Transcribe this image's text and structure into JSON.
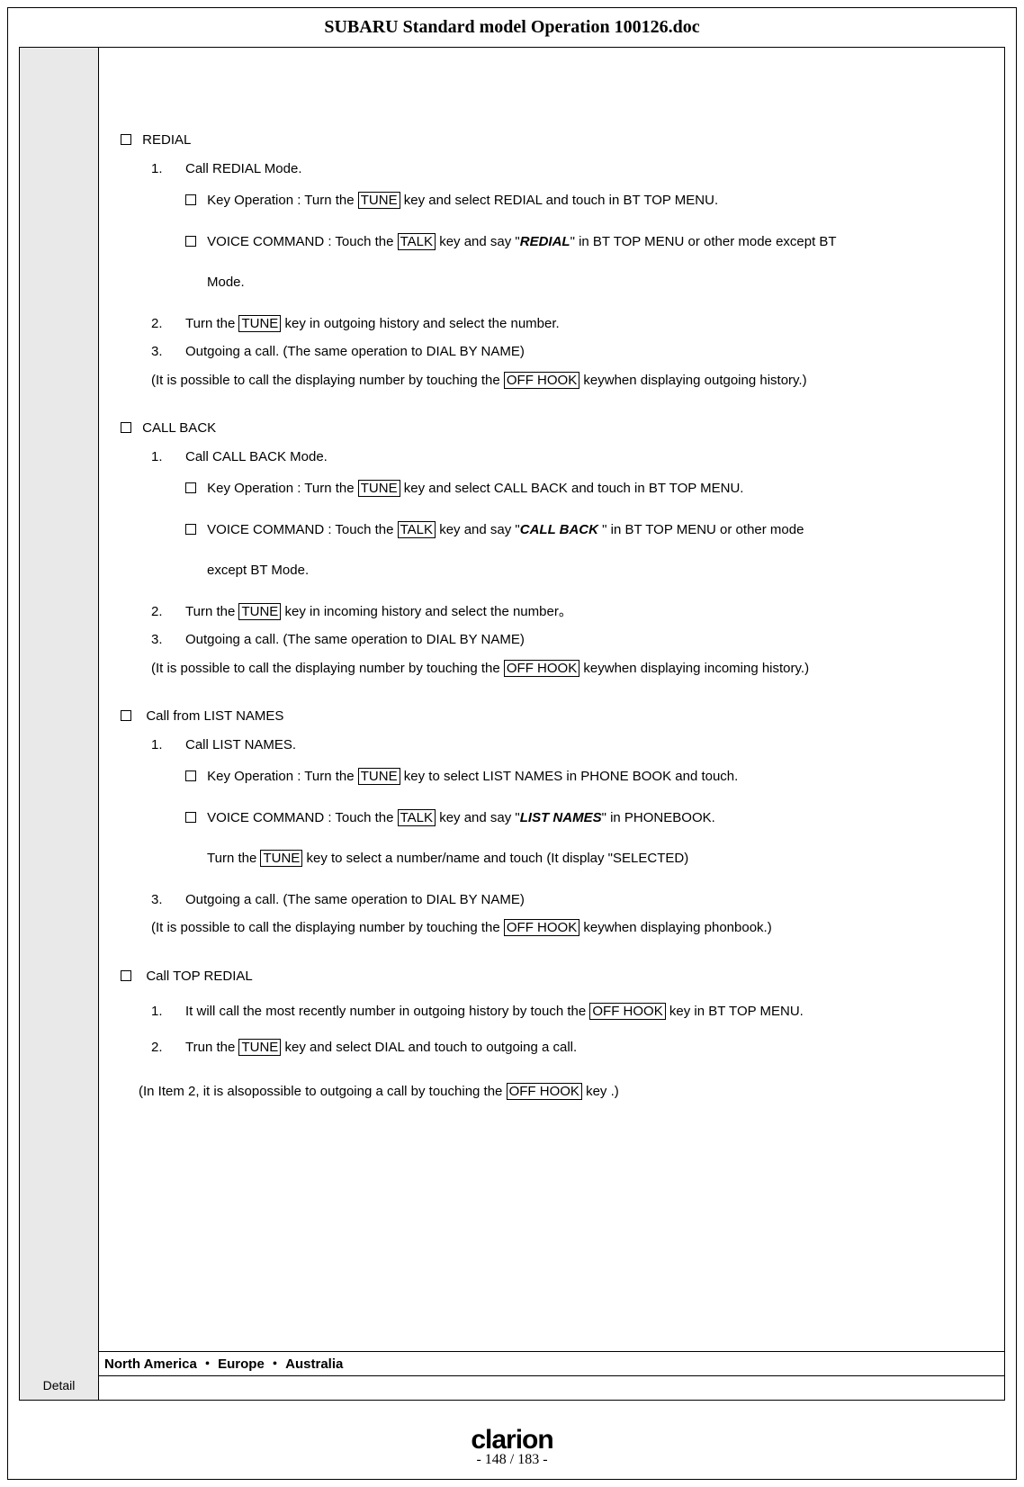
{
  "doc_title": "SUBARU Standard model Operation 100126.doc",
  "logo": "clarion",
  "page_indicator": "- 148 / 183 -",
  "regions": "North America ・ Europe ・ Australia",
  "detail_label": "Detail",
  "keys": {
    "TUNE": "TUNE",
    "TALK": "TALK",
    "OFF_HOOK": "OFF HOOK"
  },
  "sections": {
    "redial": {
      "title": "REDIAL",
      "s1_num": "1.",
      "s1": "Call REDIAL Mode.",
      "s1a_pre": "Key Operation  :  Turn the ",
      "s1a_post": " key and select REDIAL and touch in BT TOP MENU.",
      "s1b_pre": "VOICE COMMAND :  Touch the ",
      "s1b_mid": " key and say \"",
      "s1b_vc": "REDIAL",
      "s1b_post": "\" in BT TOP MENU or other mode except BT",
      "s1b_cont": "Mode.",
      "s2_num": "2.",
      "s2_pre": "Turn the ",
      "s2_post": " key in outgoing history and select the number.",
      "s3_num": "3.",
      "s3": "Outgoing a call. (The same operation to DIAL BY NAME)",
      "note_pre": " (It is possible to call the displaying number by touching the ",
      "note_post": " keywhen displaying outgoing history.)"
    },
    "callback": {
      "title": "CALL BACK",
      "s1_num": "1.",
      "s1": "Call CALL BACK Mode.",
      "s1a_pre": "Key Operation  :  Turn the ",
      "s1a_post": " key and select CALL BACK and touch in BT TOP MENU.",
      "s1b_pre": "VOICE COMMAND  :  Touch the ",
      "s1b_mid": " key and say \"",
      "s1b_vc": "CALL BACK",
      "s1b_post": " \" in BT TOP MENU or other mode",
      "s1b_cont": "except BT Mode.",
      "s2_num": "2.",
      "s2_pre": "Turn the ",
      "s2_post": " key in incoming history and select the number。",
      "s3_num": "3.",
      "s3": "Outgoing a call. (The same operation to DIAL BY NAME)",
      "note_pre": " (It is possible to call the displaying number by touching the ",
      "note_post": " keywhen displaying incoming history.)"
    },
    "listnames": {
      "title": "Call from LIST NAMES",
      "s1_num": "1.",
      "s1": "Call LIST NAMES.",
      "s1a_pre": "Key Operation  :  Turn the ",
      "s1a_post": " key to select LIST NAMES in PHONE BOOK and touch.",
      "s1b_pre": "VOICE COMMAND  :  Touch the ",
      "s1b_mid": " key and say \"",
      "s1b_vc": "LIST NAMES",
      "s1b_post": "\" in PHONEBOOK.",
      "s1c_pre": "Turn the ",
      "s1c_post": " key to select a number/name and touch (It display \"SELECTED)",
      "s3_num": "3.",
      "s3": "Outgoing a call. (The same operation to DIAL BY NAME)",
      "note_pre": " (It is possible to call the displaying number by touching the ",
      "note_post": " keywhen displaying phonbook.)"
    },
    "topredial": {
      "title": "Call TOP REDIAL",
      "s1_num": "1.",
      "s1_pre": "It will call the most recently number in outgoing history by touch the ",
      "s1_post": " key in BT TOP MENU.",
      "s2_num": "2.",
      "s2_pre": "Trun the ",
      "s2_post": " key and select DIAL and touch to outgoing a call.",
      "note_pre": " (In Item 2, it is alsopossible to outgoing a call by touching the ",
      "note_post": " key .)"
    }
  }
}
